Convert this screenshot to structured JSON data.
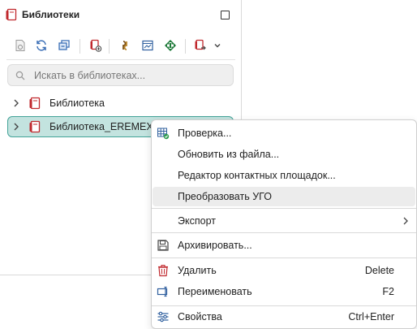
{
  "panel": {
    "title": "Библиотеки",
    "search_placeholder": "Искать в библиотеках..."
  },
  "tree": {
    "items": [
      {
        "label": "Библиотека",
        "selected": false
      },
      {
        "label": "Библиотека_EREMEX",
        "selected": true
      }
    ]
  },
  "context_menu": {
    "items": {
      "check": {
        "label": "Проверка...",
        "icon": "check-table-icon"
      },
      "refresh_from_file": {
        "label": "Обновить из файла..."
      },
      "pad_editor": {
        "label": "Редактор контактных площадок..."
      },
      "convert_symbol": {
        "label": "Преобразовать УГО"
      },
      "export": {
        "label": "Экспорт",
        "icon": "chevron-right-icon"
      },
      "archive": {
        "label": "Архивировать...",
        "icon": "save-icon"
      },
      "delete": {
        "label": "Удалить",
        "shortcut": "Delete",
        "icon": "trash-icon"
      },
      "rename": {
        "label": "Переименовать",
        "shortcut": "F2",
        "icon": "rename-icon"
      },
      "properties": {
        "label": "Свойства",
        "shortcut": "Ctrl+Enter",
        "icon": "settings-sliders-icon"
      }
    }
  },
  "colors": {
    "selection_bg": "#c3e3df",
    "selection_border": "#43a398",
    "book_red": "#c0282d",
    "hover_bg": "#ececec"
  }
}
